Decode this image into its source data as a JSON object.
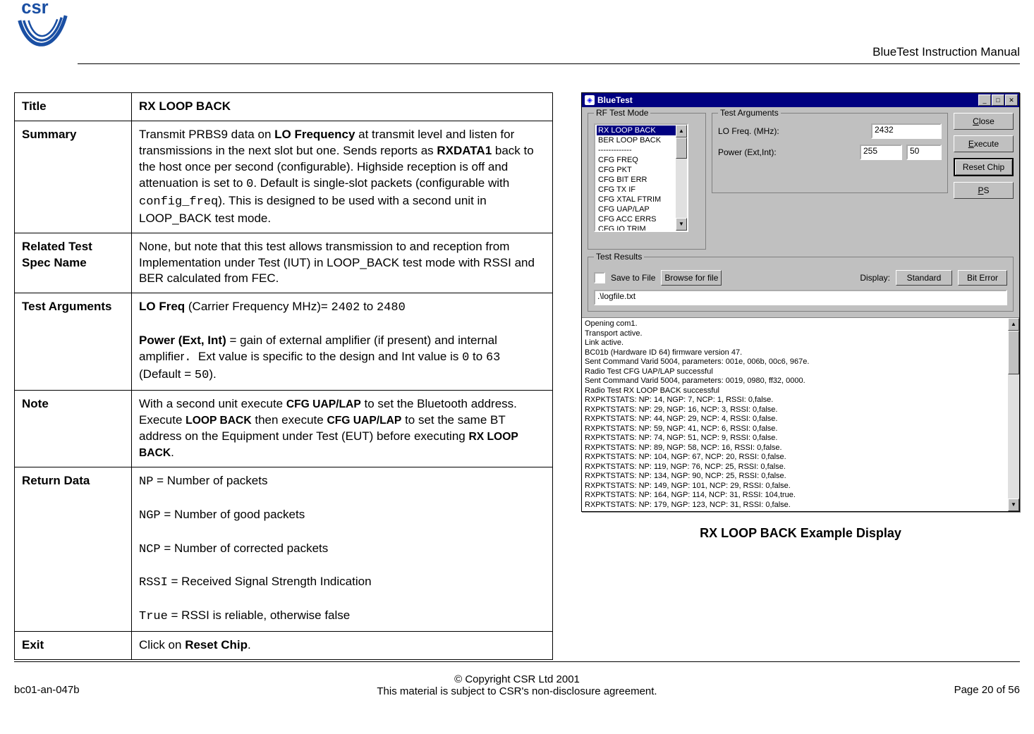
{
  "header": {
    "doc_title": "BlueTest Instruction Manual"
  },
  "spec": {
    "title_label": "Title",
    "title_value": "RX LOOP BACK",
    "summary_label": "Summary",
    "summary_html": "Transmit PRBS9 data on <span class='b'>LO Frequency</span> at transmit level and listen for transmissions in the next slot but one. Sends reports as <span class='b'>RXDATA1</span> back to the host once per second (configurable). Highside reception is off and attenuation is set to <span class='mono'>0</span>. Default is single-slot packets (configurable with <span class='mono'>config_freq</span>). This is designed to be used with a second unit in LOOP_BACK test mode.",
    "related_label": "Related Test Spec Name",
    "related_value": "None, but note that this test allows transmission to and reception from Implementation under Test (IUT) in LOOP_BACK test mode with RSSI and BER calculated from FEC.",
    "args_label": "Test Arguments",
    "args_html": "<span class='b'>LO Freq</span> (Carrier Frequency MHz)= <span class='mono'>2402</span> to <span class='mono'>2480</span><br><br><span class='b'>Power (Ext, Int)</span> = gain of external amplifier (if present) and internal amplifier<span class='mono'>.</span>&nbsp;&nbsp;Ext value is specific to the design and Int value is <span class='mono'>0</span> to <span class='mono'>63</span> (Default = <span class='mono'>50</span>).",
    "note_label": "Note",
    "note_html": "With a second unit execute <span class='b smallcaps'>CFG UAP/LAP</span> to set the Bluetooth address. Execute <span class='b smallcaps'>LOOP BACK</span> then execute <span class='b smallcaps'>CFG UAP/LAP</span> to set the same BT address on the Equipment under Test (EUT) before executing <span class='b smallcaps'>RX LOOP BACK</span>.",
    "return_label": "Return Data",
    "return_html": "<span class='mono'>NP</span> = Number of packets<br><br><span class='mono'>NGP</span> = Number of good packets<br><br><span class='mono'>NCP</span> = Number of corrected packets<br><br><span class='mono'>RSSI</span> = Received Signal Strength Indication<br><br><span class='mono'>True</span> = RSSI is reliable, otherwise false",
    "exit_label": "Exit",
    "exit_html": "Click on <span class='b'>Reset Chip</span>."
  },
  "bt": {
    "title": "BlueTest",
    "rf_group": "RF Test Mode",
    "rf_items": [
      "RX LOOP BACK",
      "BER LOOP BACK",
      "-------------",
      "CFG FREQ",
      "CFG PKT",
      "CFG BIT ERR",
      "CFG TX IF",
      "CFG XTAL FTRIM",
      "CFG UAP/LAP",
      "CFG ACC ERRS",
      "CFG IQ TRIM"
    ],
    "rf_selected_index": 0,
    "ta_group": "Test Arguments",
    "ta_lo_label": "LO Freq. (MHz):",
    "ta_lo_value": "2432",
    "ta_pw_label": "Power (Ext,Int):",
    "ta_pw_ext": "255",
    "ta_pw_int": "50",
    "btn_close": "Close",
    "btn_execute": "Execute",
    "btn_reset": "Reset Chip",
    "btn_ps": "PS",
    "tr_group": "Test Results",
    "tr_save": "Save to File",
    "tr_browse": "Browse for file",
    "tr_display": "Display:",
    "tr_standard": "Standard",
    "tr_biterror": "Bit Error",
    "tr_path": ".\\logfile.txt",
    "log": [
      "Opening com1.",
      "Transport active.",
      "Link active.",
      "BC01b (Hardware ID 64) firmware version 47.",
      "Sent Command Varid 5004, parameters: 001e, 006b, 00c6, 967e.",
      "Radio Test CFG UAP/LAP successful",
      "Sent Command Varid 5004, parameters: 0019, 0980, ff32, 0000.",
      "Radio Test RX LOOP BACK successful",
      "RXPKTSTATS: NP: 14, NGP: 7, NCP: 1, RSSI: 0,false.",
      "RXPKTSTATS: NP: 29, NGP: 16, NCP: 3, RSSI: 0,false.",
      "RXPKTSTATS: NP: 44, NGP: 29, NCP: 4, RSSI: 0,false.",
      "RXPKTSTATS: NP: 59, NGP: 41, NCP: 6, RSSI: 0,false.",
      "RXPKTSTATS: NP: 74, NGP: 51, NCP: 9, RSSI: 0,false.",
      "RXPKTSTATS: NP: 89, NGP: 58, NCP: 16, RSSI: 0,false.",
      "RXPKTSTATS: NP: 104, NGP: 67, NCP: 20, RSSI: 0,false.",
      "RXPKTSTATS: NP: 119, NGP: 76, NCP: 25, RSSI: 0,false.",
      "RXPKTSTATS: NP: 134, NGP: 90, NCP: 25, RSSI: 0,false.",
      "RXPKTSTATS: NP: 149, NGP: 101, NCP: 29, RSSI: 0,false.",
      "RXPKTSTATS: NP: 164, NGP: 114, NCP: 31, RSSI: 104,true.",
      "RXPKTSTATS: NP: 179, NGP: 123, NCP: 31, RSSI: 0,false."
    ]
  },
  "figure_caption": "RX LOOP BACK Example Display",
  "footer": {
    "left": "bc01-an-047b",
    "center_1": "© Copyright CSR Ltd 2001",
    "center_2": "This material is subject to CSR's non-disclosure agreement.",
    "right": "Page 20 of 56"
  }
}
